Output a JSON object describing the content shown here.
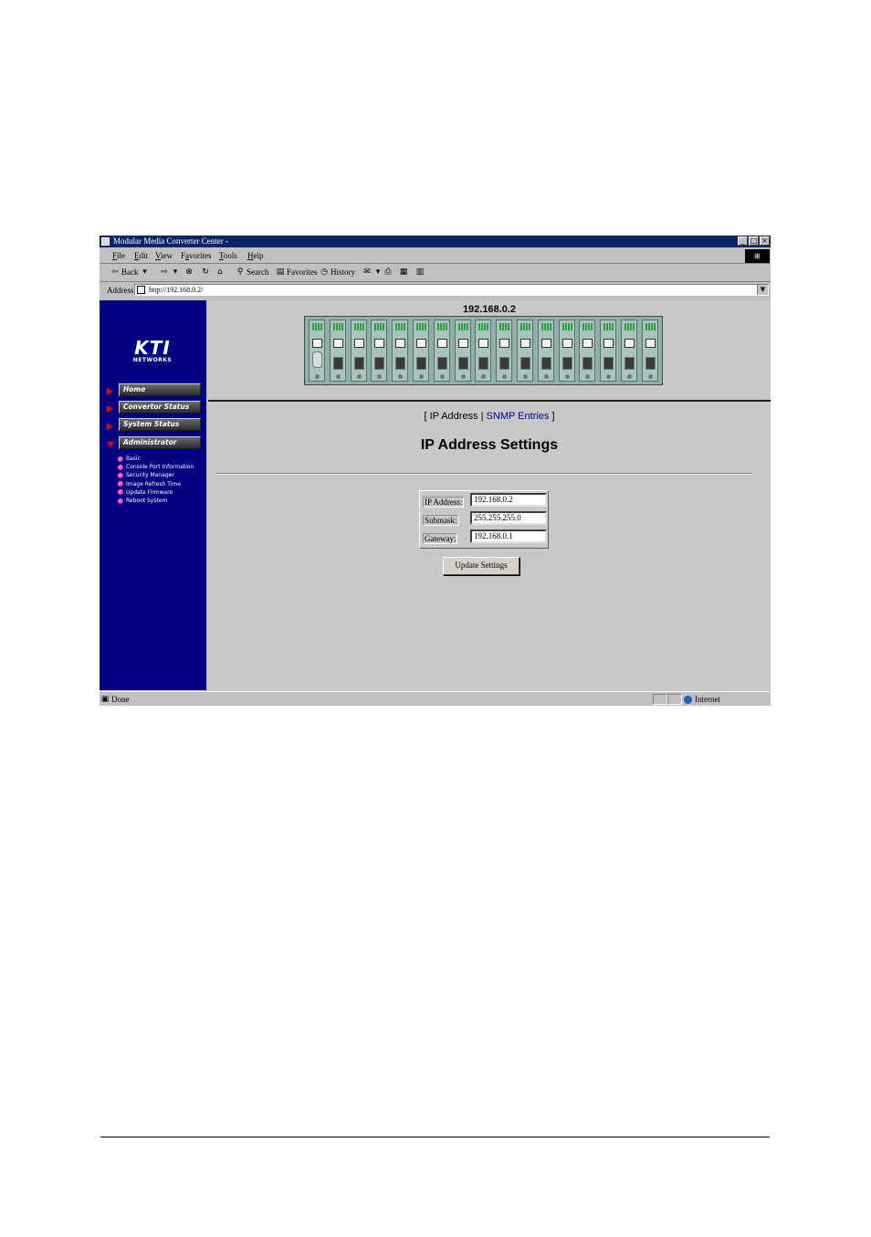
{
  "window": {
    "title": "Modular Media Converter Center -",
    "buttons": {
      "minimize": "_",
      "maximize": "□",
      "close": "×"
    }
  },
  "menu": [
    {
      "key": "F",
      "rest": "ile"
    },
    {
      "key": "E",
      "rest": "dit"
    },
    {
      "key": "V",
      "rest": "iew"
    },
    {
      "key": "",
      "pre": "F",
      "ul": "a",
      "rest": "vorites"
    },
    {
      "key": "T",
      "rest": "ools"
    },
    {
      "key": "H",
      "rest": "elp"
    }
  ],
  "toolbar": {
    "back": "Back",
    "search": "Search",
    "favorites": "Favorites",
    "history": "History"
  },
  "address": {
    "label": "Address",
    "url": "http://192.168.0.2/"
  },
  "sidebar": {
    "logo": "KTI",
    "logo_sub": "NETWORKS",
    "nav": [
      "Home",
      "Convertor Status",
      "System Status",
      "Administrator"
    ],
    "subitems": [
      "Basic",
      "Console Port Information",
      "Security Manager",
      "Image Refresh Time",
      "Update Firmware",
      "Reboot System"
    ]
  },
  "device": {
    "ip_title": "192.168.0.2"
  },
  "main": {
    "link_open": "[",
    "link_ip": "IP Address",
    "link_sep": "|",
    "link_snmp": "SNMP Entries",
    "link_close": "]",
    "heading": "IP Address Settings",
    "fields": [
      {
        "label": "IP Address:",
        "value": "192.168.0.2"
      },
      {
        "label": "Submask:",
        "value": "255.255.255.0"
      },
      {
        "label": "Gateway:",
        "value": "192.168.0.1"
      }
    ],
    "update_button": "Update Settings"
  },
  "status": {
    "left": "Done",
    "zone": "Internet"
  }
}
